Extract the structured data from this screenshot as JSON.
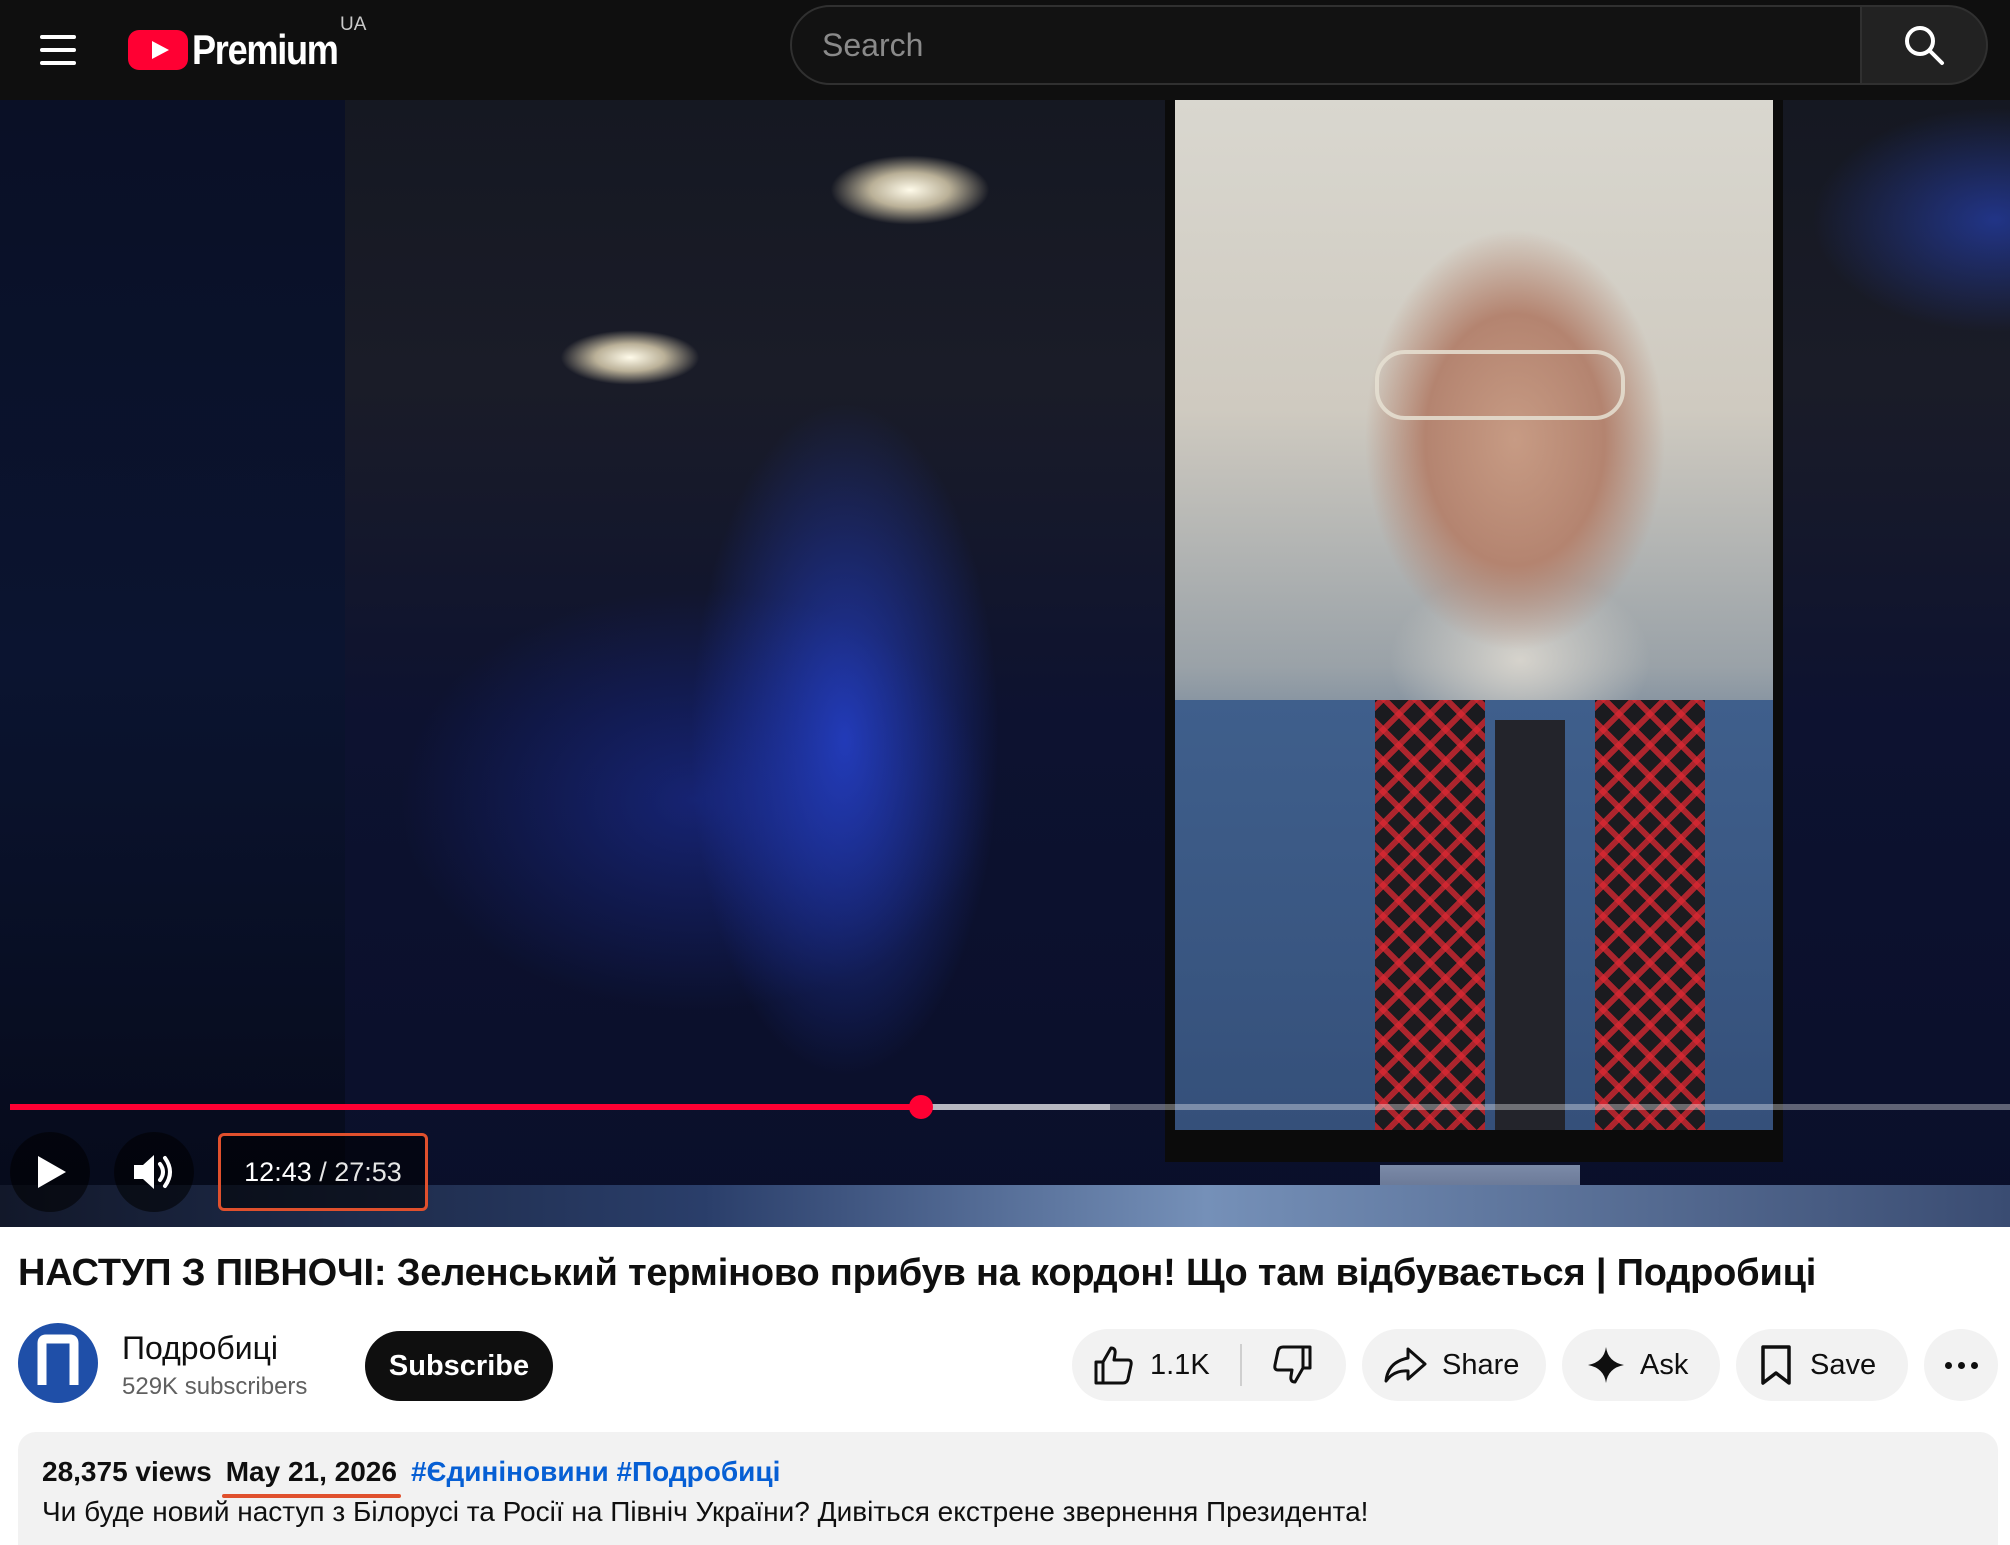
{
  "header": {
    "brand_text": "Premium",
    "country_code": "UA",
    "search_placeholder": "Search",
    "brand_color": "#ff0033"
  },
  "player": {
    "current_time": "12:43",
    "separator": " / ",
    "total_time": "27:53",
    "progress_fraction": 0.4556,
    "buffered_fraction": 0.55,
    "play_state": "paused",
    "play_icon": "play-icon",
    "volume_icon": "volume-icon",
    "highlight_color": "#e0502d"
  },
  "video": {
    "title": "НАСТУП З ПІВНОЧІ: Зеленський терміново прибув на кордон! Що там відбувається | Подробиці"
  },
  "channel": {
    "name": "Подробиці",
    "subscribers": "529K subscribers",
    "subscribe_label": "Subscribe",
    "avatar_color": "#1f4fa8"
  },
  "actions": {
    "like_count": "1.1K",
    "share_label": "Share",
    "ask_label": "Ask",
    "save_label": "Save"
  },
  "description": {
    "views": "28,375 views",
    "date": "May 21, 2026",
    "hashtags": "#Єдиніновини #Подробиці",
    "text": "Чи буде новий наступ з Білорусі та Росії на Північ України? Дивіться екстрене звернення Президента!"
  }
}
